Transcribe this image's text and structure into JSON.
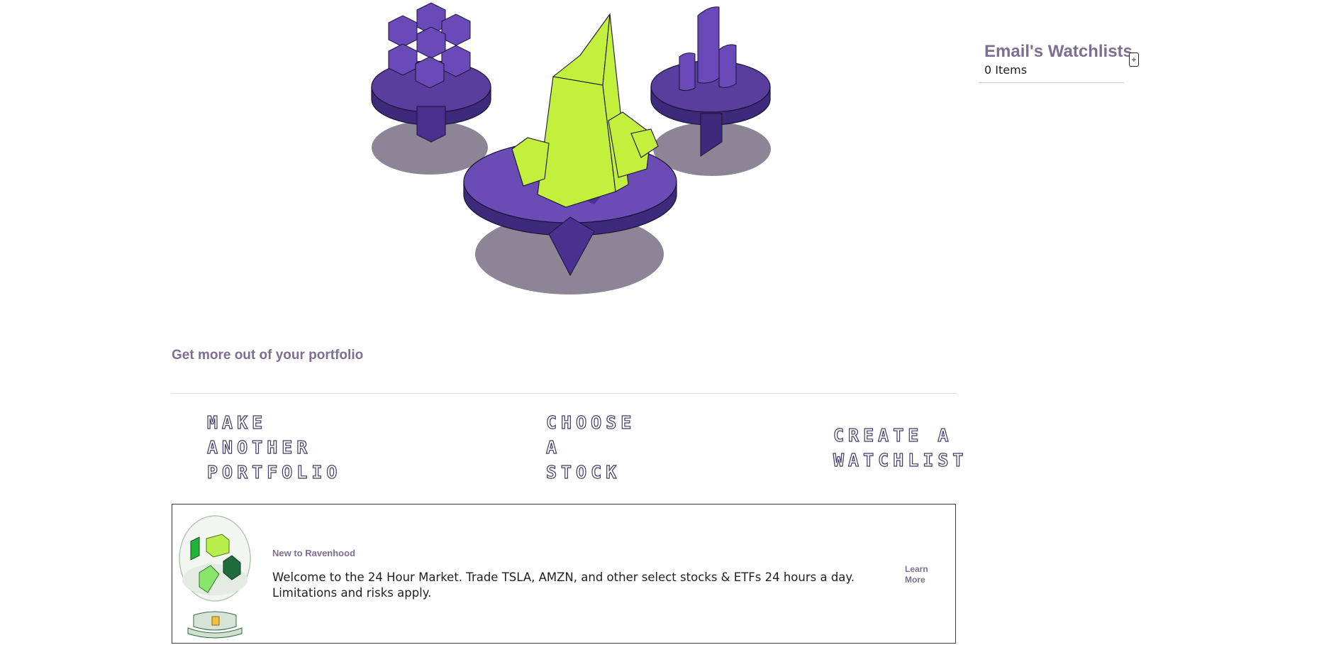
{
  "portfolio": {
    "tagline": "Get more out of your portfolio",
    "actions": {
      "make_portfolio": "MAKE\nANOTHER\nPORTFOLIO",
      "choose_stock": "CHOOSE\nA\nSTOCK",
      "create_watchlist": "CREATE A\nWATCHLIST"
    }
  },
  "news": {
    "eyebrow": "New to Ravenhood",
    "body": "Welcome to the 24 Hour Market. Trade TSLA, AMZN, and other select stocks & ETFs 24 hours a day. Limitations and risks apply.",
    "learn_more": "Learn More"
  },
  "watchlists": {
    "title": "Email's Watchlists",
    "count": "0 Items",
    "add_label": "+"
  },
  "colors": {
    "accent_purple": "#7c6f92",
    "hero_purple": "#5a3e9e",
    "hero_green": "#c3f03c",
    "shadow": "#8b8595"
  },
  "icons": {
    "hero": "crystal-pedestals-illustration",
    "news": "snow-globe-icon",
    "add": "plus-icon"
  }
}
